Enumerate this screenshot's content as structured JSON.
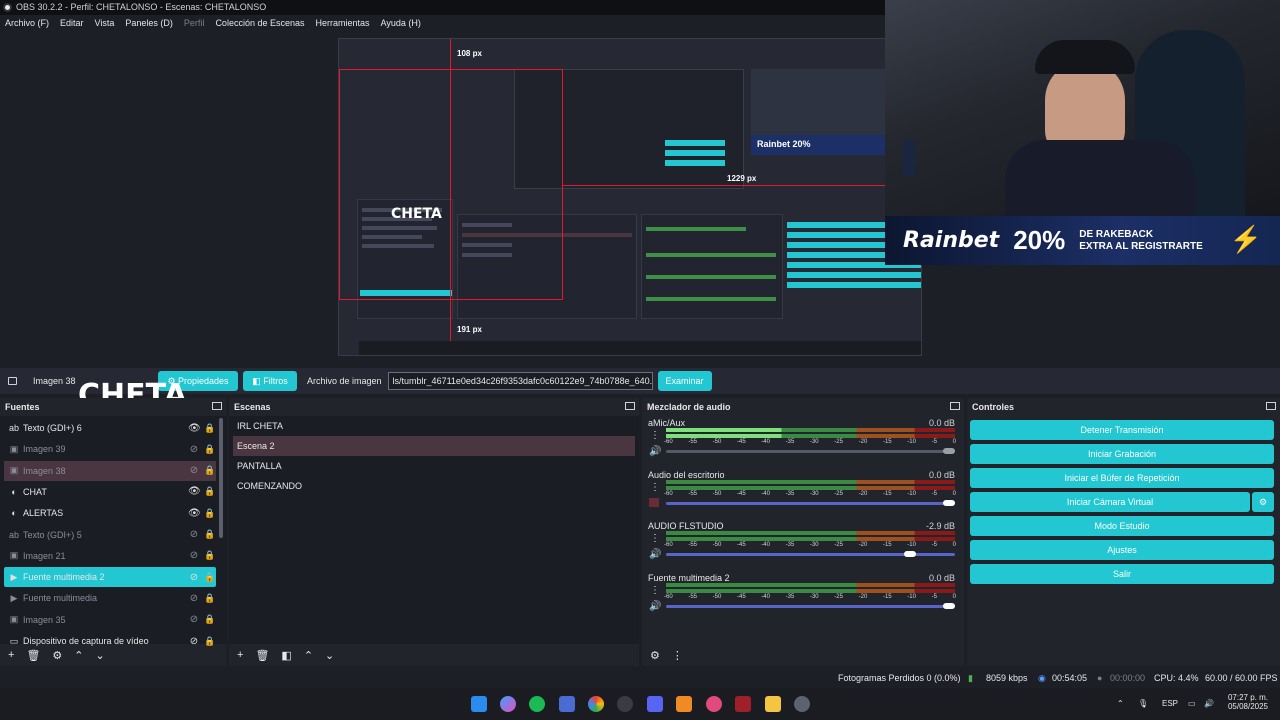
{
  "window": {
    "title": "OBS 30.2.2 - Perfil: CHETALONSO - Escenas: CHETALONSO"
  },
  "menu": [
    "Archivo (F)",
    "Editar",
    "Vista",
    "Paneles (D)",
    "Perfil",
    "Colección de Escenas",
    "Herramientas",
    "Ayuda (H)"
  ],
  "preview": {
    "measure_top": "108 px",
    "measure_right": "1229 px",
    "measure_bottom": "191 px",
    "overlay_text": "CHETA"
  },
  "ad": {
    "brand": "Rainbet",
    "percent": "20%",
    "line1": "DE RAKEBACK",
    "line2": "EXTRA AL REGISTRARTE"
  },
  "source_toolbar": {
    "source_name": "Imagen 38",
    "properties": "Propiedades",
    "filters": "Filtros",
    "file_label": "Archivo de imagen",
    "file_path": "ls/tumblr_46711e0ed34c26f9353dafc0c60122e9_74b0788e_640.gif",
    "browse": "Examinar"
  },
  "overlay_cheta": "CHETA",
  "sources": {
    "title": "Fuentes",
    "items": [
      {
        "label": "Texto (GDI+) 6",
        "icon": "ab",
        "dim": false,
        "visible": true
      },
      {
        "label": "Imagen 39",
        "icon": "▣",
        "dim": true,
        "visible": false
      },
      {
        "label": "Imagen 38",
        "icon": "▣",
        "dim": true,
        "visible": false
      },
      {
        "label": "CHAT",
        "icon": "◐",
        "dim": false,
        "visible": true
      },
      {
        "label": "ALERTAS",
        "icon": "◐",
        "dim": false,
        "visible": true
      },
      {
        "label": "Texto (GDI+) 5",
        "icon": "ab",
        "dim": true,
        "visible": false
      },
      {
        "label": "Imagen 21",
        "icon": "▣",
        "dim": true,
        "visible": false
      },
      {
        "label": "Fuente multimedia 2",
        "icon": "▶",
        "dim": false,
        "visible": false
      },
      {
        "label": "Fuente multimedia",
        "icon": "▶",
        "dim": true,
        "visible": false
      },
      {
        "label": "Imagen 35",
        "icon": "▣",
        "dim": true,
        "visible": false
      },
      {
        "label": "Dispositivo de captura de vídeo",
        "icon": "▭",
        "dim": false,
        "visible": false
      }
    ]
  },
  "scenes": {
    "title": "Escenas",
    "items": [
      "IRL CHETA",
      "Escena 2",
      "PANTALLA",
      "COMENZANDO"
    ]
  },
  "mixer": {
    "title": "Mezclador de audio",
    "ticks": [
      "-60",
      "-55",
      "-50",
      "-45",
      "-40",
      "-35",
      "-30",
      "-25",
      "-20",
      "-15",
      "-10",
      "-5",
      "0"
    ],
    "channels": [
      {
        "name": "aMic/Aux",
        "db": "0.0 dB",
        "level": 0.4,
        "fader": 1.0
      },
      {
        "name": "Audio del escritorio",
        "db": "0.0 dB",
        "level": 0,
        "fader": 1.0
      },
      {
        "name": "AUDIO FLSTUDIO",
        "db": "-2.9 dB",
        "level": 0,
        "fader": 0.86
      },
      {
        "name": "Fuente multimedia 2",
        "db": "0.0 dB",
        "level": 0,
        "fader": 1.0
      }
    ]
  },
  "controls": {
    "title": "Controles",
    "buttons": [
      "Detener Transmisión",
      "Iniciar Grabación",
      "Iniciar el Búfer de Repetición",
      "Iniciar Cámara Virtual",
      "Modo Estudio",
      "Ajustes",
      "Salir"
    ]
  },
  "status": {
    "dropped": "Fotogramas Perdidos 0 (0.0%)",
    "bitrate": "8059 kbps",
    "stream_time": "00:54:05",
    "rec_time": "00:00:00",
    "cpu": "CPU: 4.4%",
    "fps": "60.00 / 60.00 FPS"
  },
  "taskbar": {
    "lang": "ESP",
    "time": "07:27 p. m.",
    "date": "05/08/2025"
  },
  "colors": {
    "accent": "#22c7d2",
    "selected_scene": "#4a3640",
    "meter_green": "#4caf50",
    "meter_red": "#c0392b"
  }
}
